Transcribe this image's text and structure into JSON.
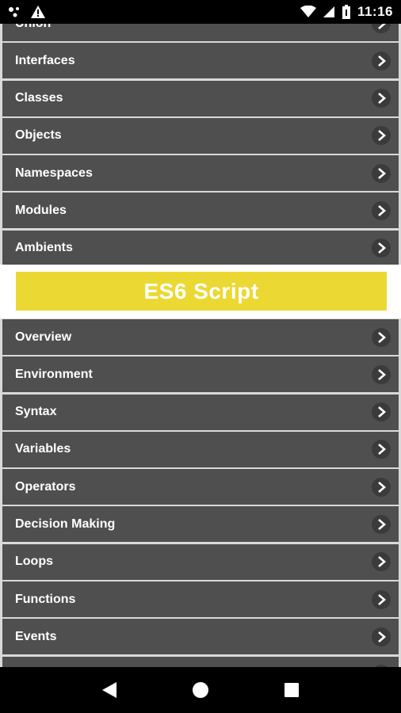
{
  "status_bar": {
    "time": "11:16",
    "icons": [
      "notification-dots-icon",
      "warning-icon",
      "wifi-icon",
      "battery-icon"
    ]
  },
  "list_top": {
    "items": [
      {
        "label": "Union"
      },
      {
        "label": "Interfaces"
      },
      {
        "label": "Classes"
      },
      {
        "label": "Objects"
      },
      {
        "label": "Namespaces"
      },
      {
        "label": "Modules"
      },
      {
        "label": "Ambients"
      }
    ]
  },
  "section": {
    "title": "ES6 Script",
    "accent_color": "#ecd832"
  },
  "list_bottom": {
    "items": [
      {
        "label": "Overview"
      },
      {
        "label": "Environment"
      },
      {
        "label": "Syntax"
      },
      {
        "label": "Variables"
      },
      {
        "label": "Operators"
      },
      {
        "label": "Decision Making"
      },
      {
        "label": "Loops"
      },
      {
        "label": "Functions"
      },
      {
        "label": "Events"
      },
      {
        "label": ""
      }
    ]
  },
  "nav_bar": {
    "buttons": [
      "back-icon",
      "home-icon",
      "recents-icon"
    ]
  },
  "colors": {
    "row_bg": "#4f4f4f",
    "background": "#d9d9d9"
  }
}
